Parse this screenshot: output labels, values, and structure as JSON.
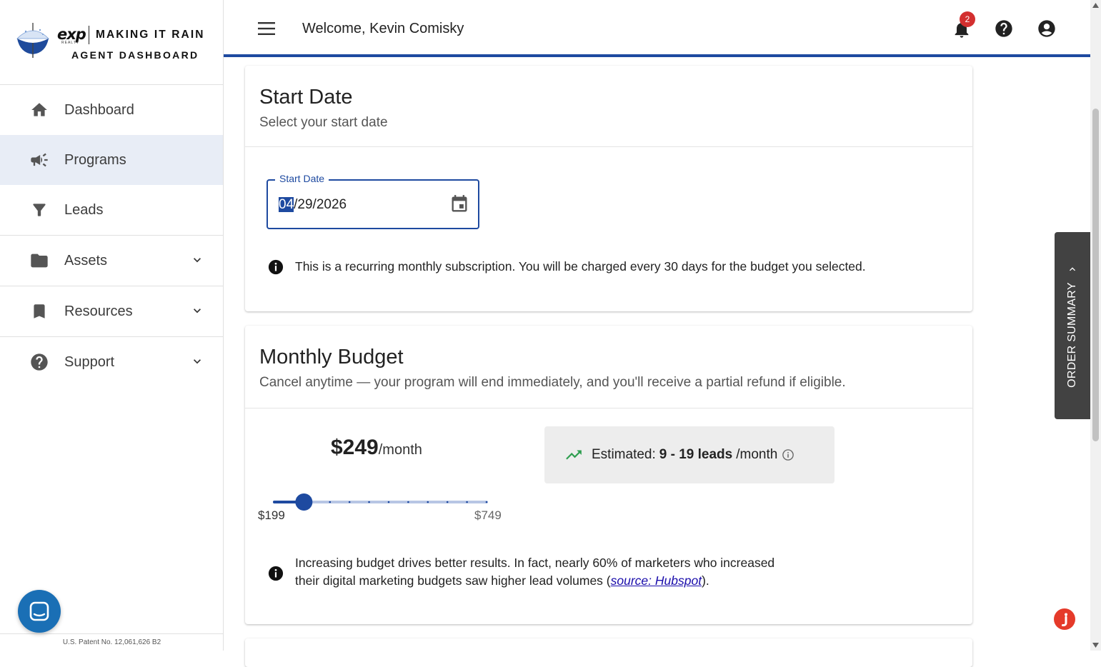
{
  "brand": {
    "company": "exp",
    "company_sub": "REALTY",
    "line1": "MAKING IT RAIN",
    "line2": "AGENT DASHBOARD"
  },
  "sidebar": {
    "items": [
      {
        "label": "Dashboard",
        "icon": "home-icon"
      },
      {
        "label": "Programs",
        "icon": "megaphone-icon",
        "active": true
      },
      {
        "label": "Leads",
        "icon": "filter-icon"
      },
      {
        "label": "Assets",
        "icon": "folder-icon",
        "expandable": true
      },
      {
        "label": "Resources",
        "icon": "bookmark-icon",
        "expandable": true
      },
      {
        "label": "Support",
        "icon": "help-circle-icon",
        "expandable": true
      }
    ],
    "patent": "U.S. Patent No. 12,061,626 B2"
  },
  "header": {
    "welcome": "Welcome, Kevin Comisky",
    "notification_count": "2",
    "accent_color": "#1e4aa0"
  },
  "start_date": {
    "title": "Start Date",
    "subtitle": "Select your start date",
    "field_label": "Start Date",
    "value_month": "04",
    "value_rest": "/29/2026",
    "notice": "This is a recurring monthly subscription. You will be charged every 30 days for the budget you selected."
  },
  "budget": {
    "title": "Monthly Budget",
    "subtitle": "Cancel anytime — your program will end immediately, and you'll receive a partial refund if eligible.",
    "price": "$249",
    "per": "/month",
    "slider_min_label": "$199",
    "slider_max_label": "$749",
    "slider_min": 199,
    "slider_max": 749,
    "slider_value": 249,
    "estimate_prefix": "Estimated:",
    "estimate_range": "9 - 19 leads",
    "estimate_suffix": "/month",
    "tip_text": "Increasing budget drives better results. In fact, nearly 60% of marketers who increased their digital marketing budgets saw higher lead volumes (",
    "tip_link": "source: Hubspot",
    "tip_end": ")."
  },
  "order_summary": {
    "label": "ORDER SUMMARY"
  }
}
